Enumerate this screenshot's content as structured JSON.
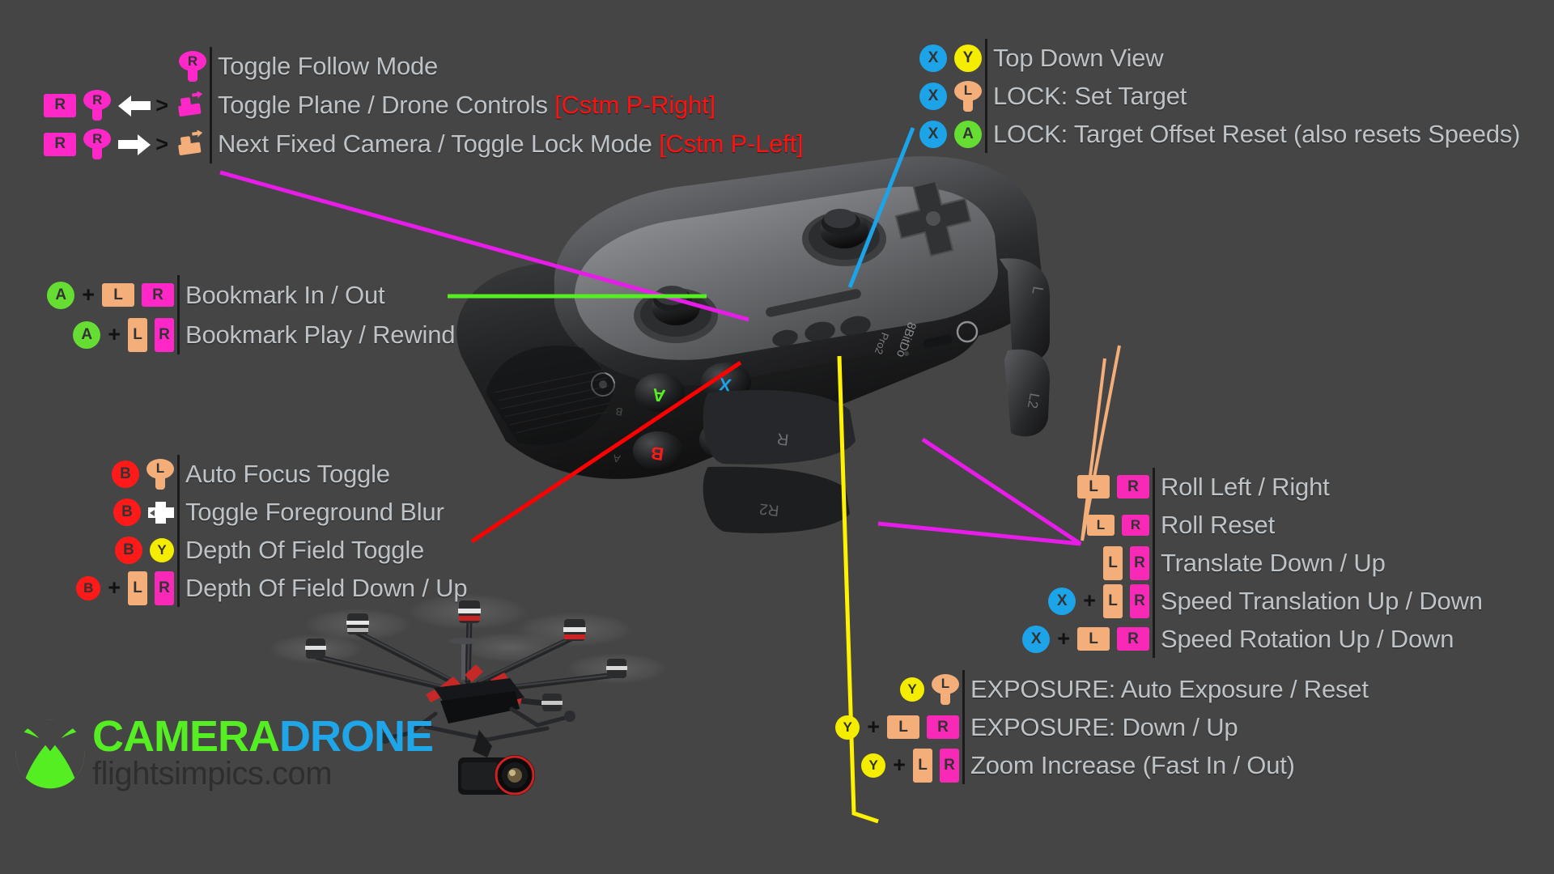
{
  "page": {
    "background_color": "#454545",
    "title": "CameraDrone Controller Map"
  },
  "colors": {
    "x_button": "#1CA3E8",
    "y_button": "#F5ED00",
    "a_button": "#66DD33",
    "b_button": "#FF1A1A",
    "peach": "#F4AE79",
    "pink": "#FF27C8",
    "magenta": "#F929B8",
    "label_text": "#BDC3C7",
    "cstm_text": "#FF1111",
    "line_magenta": "#E81CE8",
    "line_green": "#55EE22",
    "line_red": "#FF0000",
    "line_yellow": "#FFF200",
    "line_cyan": "#1CA3E8",
    "line_peach": "#F4AE79"
  },
  "groups": {
    "top_left": {
      "name": "camera-mode-group",
      "rows": [
        {
          "keys": [
            {
              "type": "stick",
              "color": "pink",
              "label": "R",
              "name": "right-stick-icon"
            }
          ],
          "label": "Toggle Follow Mode",
          "suffix": ""
        },
        {
          "keys": [
            {
              "type": "bump",
              "color": "pink",
              "label": "R",
              "name": "r-bumper-icon"
            },
            {
              "type": "stick",
              "color": "pink",
              "label": "R",
              "name": "right-stick-icon"
            },
            {
              "type": "arrow",
              "dir": "left",
              "name": "arrow-left-icon"
            },
            {
              "type": "chevron",
              "label": ">",
              "name": "chevron-right-icon"
            },
            {
              "type": "moviecam",
              "color": "pink",
              "name": "movie-camera-icon"
            }
          ],
          "label": "Toggle Plane / Drone Controls",
          "suffix": "[Cstm P-Right]"
        },
        {
          "keys": [
            {
              "type": "bump",
              "color": "pink",
              "label": "R",
              "name": "r-bumper-icon"
            },
            {
              "type": "stick",
              "color": "pink",
              "label": "R",
              "name": "right-stick-icon"
            },
            {
              "type": "arrow",
              "dir": "right",
              "name": "arrow-right-icon"
            },
            {
              "type": "chevron",
              "label": ">",
              "name": "chevron-right-icon"
            },
            {
              "type": "moviecam",
              "color": "peach",
              "name": "movie-camera-icon"
            }
          ],
          "label": "Next Fixed Camera / Toggle Lock Mode",
          "suffix": "[Cstm P-Left]"
        }
      ]
    },
    "top_right": {
      "name": "lock-view-group",
      "rows": [
        {
          "keys": [
            {
              "type": "round",
              "color": "x",
              "label": "X",
              "name": "x-button-icon"
            },
            {
              "type": "round",
              "color": "y",
              "label": "Y",
              "name": "y-button-icon"
            }
          ],
          "label": "Top Down View"
        },
        {
          "keys": [
            {
              "type": "round",
              "color": "x",
              "label": "X",
              "name": "x-button-icon"
            },
            {
              "type": "stick",
              "color": "peach",
              "label": "L",
              "name": "left-stick-icon"
            }
          ],
          "label": "LOCK: Set Target"
        },
        {
          "keys": [
            {
              "type": "round",
              "color": "x",
              "label": "X",
              "name": "x-button-icon"
            },
            {
              "type": "round",
              "color": "a",
              "label": "A",
              "name": "a-button-icon"
            }
          ],
          "label": "LOCK: Target Offset Reset (also resets Speeds)"
        }
      ]
    },
    "mid_left": {
      "name": "bookmark-group",
      "rows": [
        {
          "keys": [
            {
              "type": "round",
              "color": "a",
              "label": "A",
              "name": "a-button-icon"
            },
            {
              "type": "plus",
              "label": "+",
              "name": "plus-sign"
            },
            {
              "type": "bump",
              "color": "peach",
              "label": "L",
              "name": "l-bumper-icon"
            },
            {
              "type": "bump",
              "color": "pink",
              "label": "R",
              "name": "r-bumper-icon"
            }
          ],
          "label": "Bookmark In / Out"
        },
        {
          "keys": [
            {
              "type": "round",
              "color": "a",
              "label": "A",
              "name": "a-button-icon"
            },
            {
              "type": "plus",
              "label": "+",
              "name": "plus-sign"
            },
            {
              "type": "trig",
              "color": "peach",
              "label": "L",
              "name": "l-trigger-icon"
            },
            {
              "type": "trig",
              "color": "pink",
              "label": "R",
              "name": "r-trigger-icon"
            }
          ],
          "label": "Bookmark Play / Rewind"
        }
      ]
    },
    "bottom_left": {
      "name": "focus-group",
      "rows": [
        {
          "keys": [
            {
              "type": "round",
              "color": "b",
              "label": "B",
              "name": "b-button-icon"
            },
            {
              "type": "stick",
              "color": "peach",
              "label": "L",
              "name": "left-stick-icon"
            }
          ],
          "label": "Auto Focus Toggle"
        },
        {
          "keys": [
            {
              "type": "round",
              "color": "b",
              "label": "B",
              "name": "b-button-icon"
            },
            {
              "type": "dpad",
              "name": "dpad-left-icon"
            }
          ],
          "label": "Toggle Foreground Blur"
        },
        {
          "keys": [
            {
              "type": "round",
              "color": "b",
              "label": "B",
              "name": "b-button-icon"
            },
            {
              "type": "round",
              "color": "y",
              "label": "Y",
              "name": "y-button-icon",
              "small": true
            }
          ],
          "label": "Depth Of Field Toggle"
        },
        {
          "keys": [
            {
              "type": "round",
              "color": "b",
              "label": "B",
              "name": "b-button-icon",
              "small": true
            },
            {
              "type": "plus",
              "label": "+",
              "name": "plus-sign"
            },
            {
              "type": "trig",
              "color": "peach",
              "label": "L",
              "name": "l-trigger-icon"
            },
            {
              "type": "trig",
              "color": "magenta",
              "label": "R",
              "name": "r-trigger-icon"
            }
          ],
          "label": "Depth Of Field Down / Up"
        }
      ]
    },
    "mid_right": {
      "name": "roll-translate-group",
      "rows": [
        {
          "keys": [
            {
              "type": "bump",
              "color": "peach",
              "label": "L",
              "name": "l-bumper-icon"
            },
            {
              "type": "bump",
              "color": "magenta",
              "label": "R",
              "name": "r-bumper-icon"
            }
          ],
          "label": "Roll Left / Right"
        },
        {
          "keys": [
            {
              "type": "bumpsm",
              "color": "peach",
              "label": "L",
              "name": "l-bumper-icon"
            },
            {
              "type": "bumpsm",
              "color": "magenta",
              "label": "R",
              "name": "r-bumper-icon"
            }
          ],
          "label": "Roll Reset"
        },
        {
          "keys": [
            {
              "type": "trig",
              "color": "peach",
              "label": "L",
              "name": "l-trigger-icon"
            },
            {
              "type": "trig",
              "color": "magenta",
              "label": "R",
              "name": "r-trigger-icon"
            }
          ],
          "label": "Translate Down / Up"
        },
        {
          "keys": [
            {
              "type": "round",
              "color": "x",
              "label": "X",
              "name": "x-button-icon"
            },
            {
              "type": "plus",
              "label": "+",
              "name": "plus-sign"
            },
            {
              "type": "trig",
              "color": "peach",
              "label": "L",
              "name": "l-trigger-icon"
            },
            {
              "type": "trig",
              "color": "magenta",
              "label": "R",
              "name": "r-trigger-icon"
            }
          ],
          "label": "Speed Translation Up / Down"
        },
        {
          "keys": [
            {
              "type": "round",
              "color": "x",
              "label": "X",
              "name": "x-button-icon"
            },
            {
              "type": "plus",
              "label": "+",
              "name": "plus-sign"
            },
            {
              "type": "bump",
              "color": "peach",
              "label": "L",
              "name": "l-bumper-icon"
            },
            {
              "type": "bump",
              "color": "magenta",
              "label": "R",
              "name": "r-bumper-icon"
            }
          ],
          "label": "Speed Rotation Up / Down"
        }
      ]
    },
    "bottom_right": {
      "name": "exposure-group",
      "rows": [
        {
          "keys": [
            {
              "type": "round",
              "color": "y",
              "label": "Y",
              "name": "y-button-icon",
              "small": true
            },
            {
              "type": "stick",
              "color": "peach",
              "label": "L",
              "name": "left-stick-icon"
            }
          ],
          "label": "EXPOSURE: Auto Exposure / Reset"
        },
        {
          "keys": [
            {
              "type": "round",
              "color": "y",
              "label": "Y",
              "name": "y-button-icon",
              "small": true
            },
            {
              "type": "plus",
              "label": "+",
              "name": "plus-sign"
            },
            {
              "type": "bump",
              "color": "peach",
              "label": "L",
              "name": "l-bumper-icon"
            },
            {
              "type": "bump",
              "color": "magenta",
              "label": "R",
              "name": "r-bumper-icon"
            }
          ],
          "label": "EXPOSURE: Down / Up"
        },
        {
          "keys": [
            {
              "type": "round",
              "color": "y",
              "label": "Y",
              "name": "y-button-icon",
              "small": true
            },
            {
              "type": "plus",
              "label": "+",
              "name": "plus-sign"
            },
            {
              "type": "trig",
              "color": "peach",
              "label": "L",
              "name": "l-trigger-icon"
            },
            {
              "type": "trig",
              "color": "magenta",
              "label": "R",
              "name": "r-trigger-icon"
            }
          ],
          "label": "Zoom Increase (Fast In / Out)"
        }
      ]
    }
  },
  "logo": {
    "name": "cameradrone-logo",
    "icon": "xbox-sphere-icon",
    "word1": "CAMERA",
    "word2": "DRONE",
    "subtitle": "flightsimpics.com"
  },
  "artwork": {
    "controller": "8bitdo-pro2-gamepad-image",
    "drone": "hexacopter-drone-image"
  }
}
